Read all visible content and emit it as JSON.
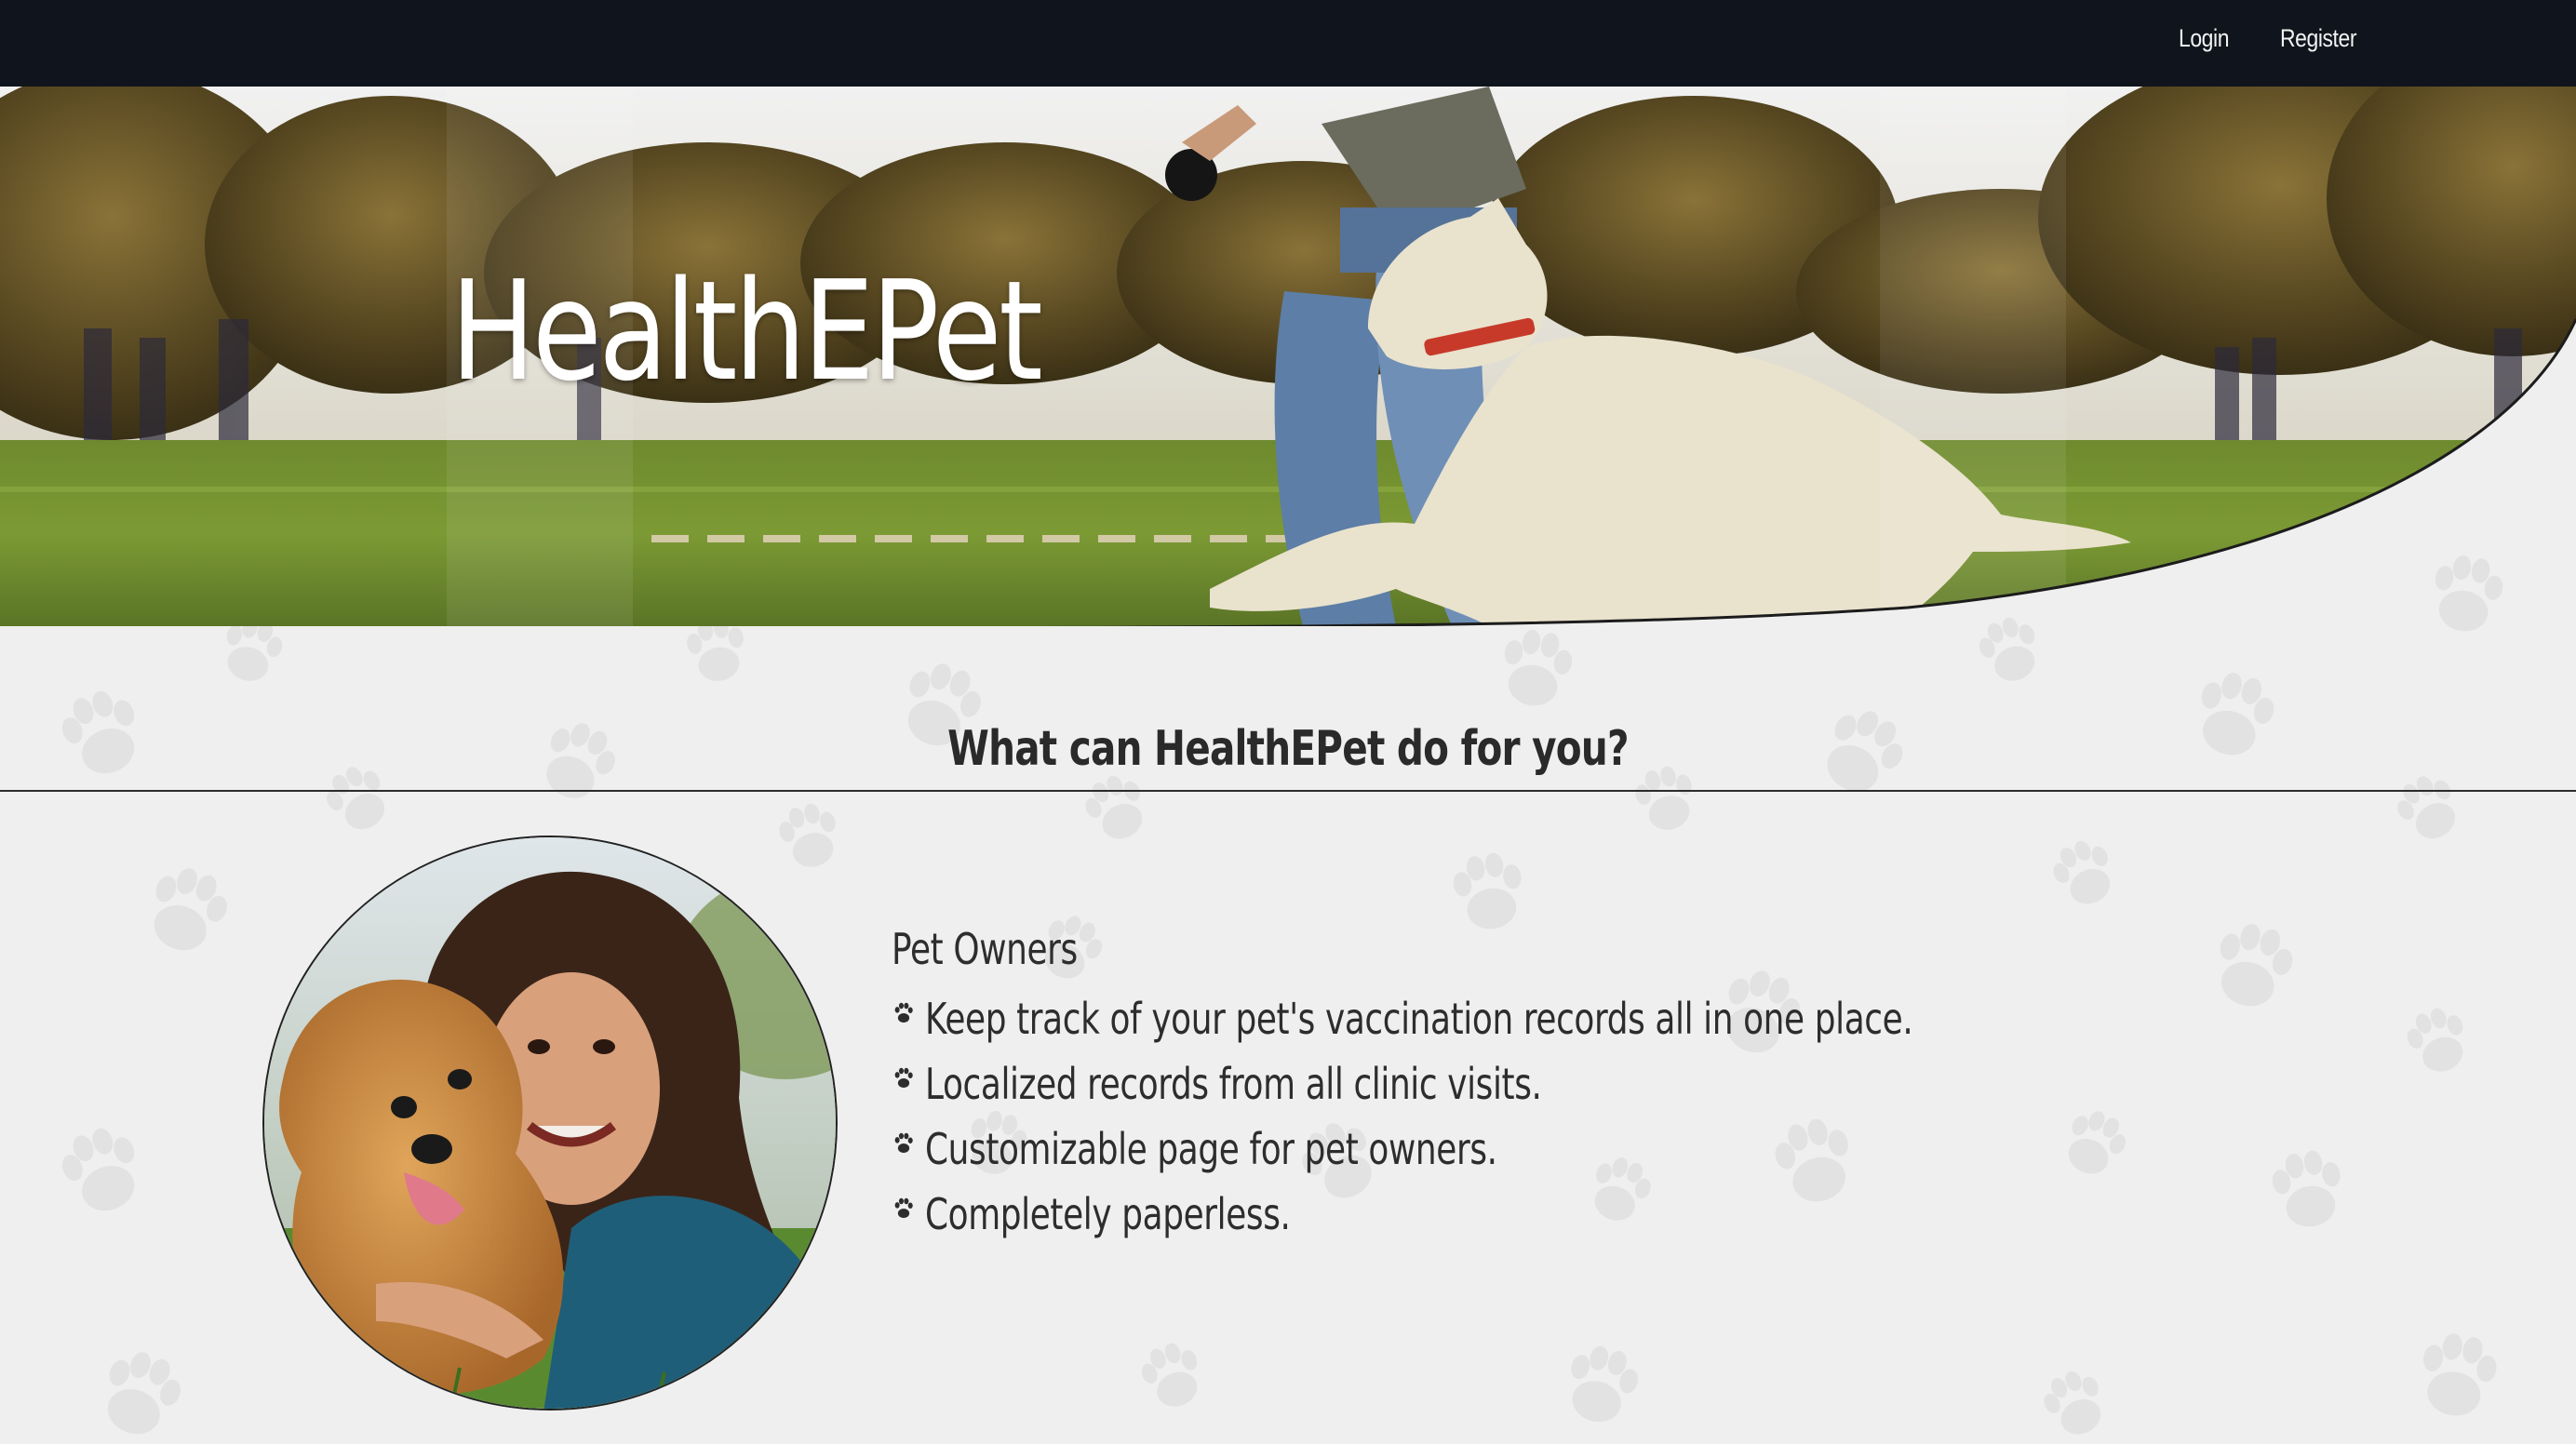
{
  "nav": {
    "login_label": "Login",
    "register_label": "Register"
  },
  "hero": {
    "brand_title": "HealthEPet"
  },
  "section": {
    "heading": "What can HealthEPet do for you?"
  },
  "features": {
    "title": "Pet Owners",
    "items": [
      "Keep track of your pet's vaccination records all in one place.",
      "Localized records from all clinic visits.",
      "Customizable page for pet owners.",
      "Completely paperless."
    ]
  },
  "icons": {
    "bullet": "paw-icon"
  },
  "colors": {
    "nav_bg": "#10141c",
    "page_bg": "#efefef",
    "text": "#2d2d2d"
  }
}
